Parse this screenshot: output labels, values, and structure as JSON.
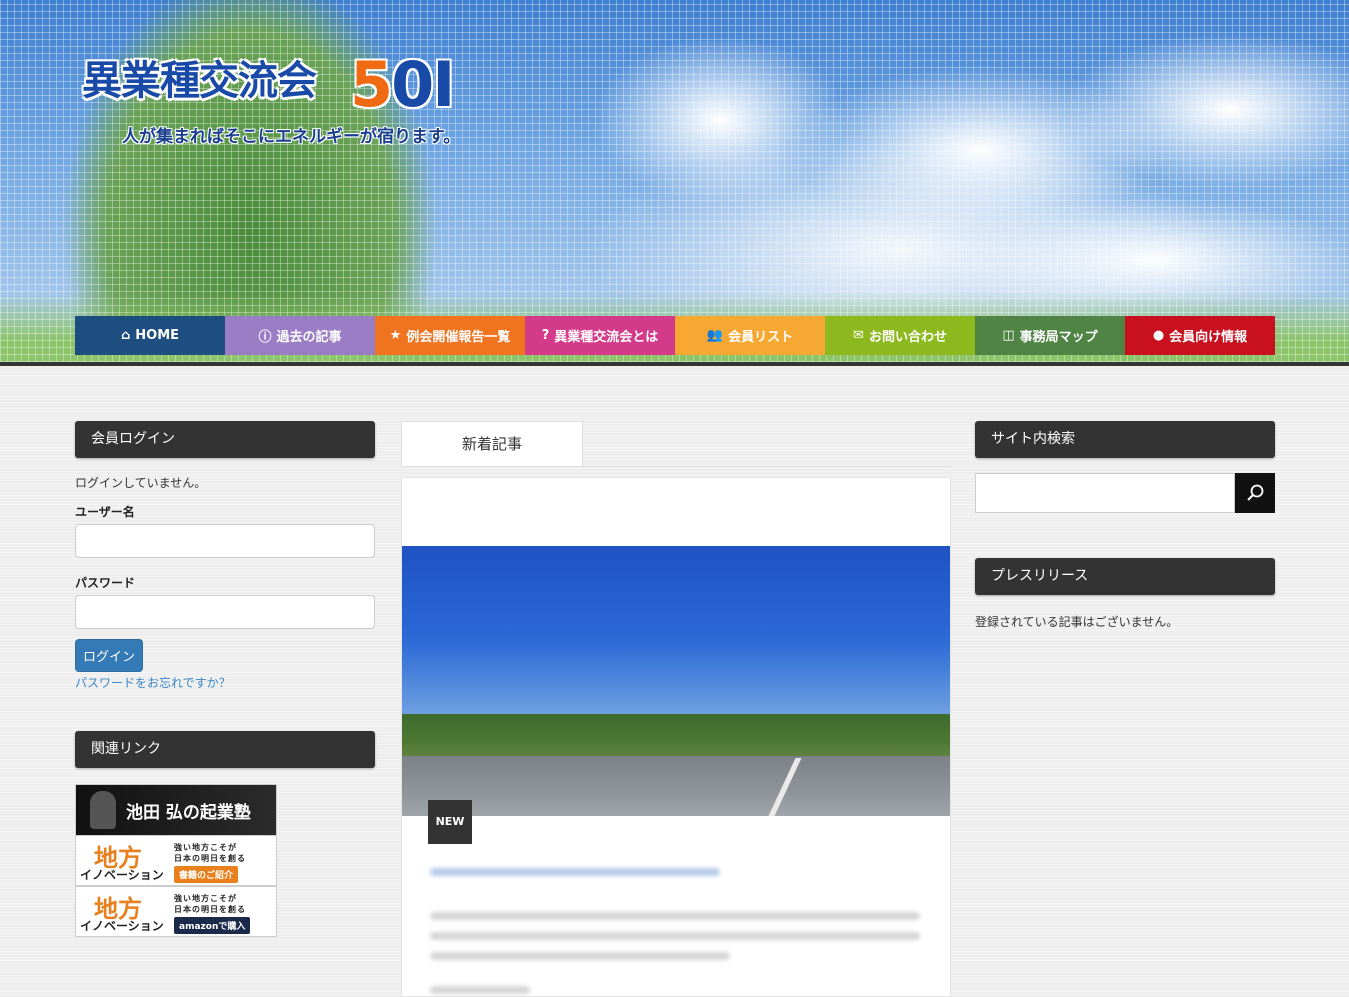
{
  "header": {
    "logo_title": "異業種交流会",
    "logo_number_5": "5",
    "logo_number_rest": "0I",
    "tagline": "人が集まればそこにエネルギーが宿ります。"
  },
  "nav": {
    "items": [
      {
        "label": "HOME",
        "icon": "home-icon",
        "color": "#1d4e7f"
      },
      {
        "label": "過去の記事",
        "icon": "info-icon",
        "color": "#9b7dc6"
      },
      {
        "label": "例会開催報告一覧",
        "icon": "star-icon",
        "color": "#f0731f"
      },
      {
        "label": "異業種交流会とは",
        "icon": "question-icon",
        "color": "#d33a8a"
      },
      {
        "label": "会員リスト",
        "icon": "users-icon",
        "color": "#f7a833"
      },
      {
        "label": "お問い合わせ",
        "icon": "envelope-icon",
        "color": "#8db91f"
      },
      {
        "label": "事務局マップ",
        "icon": "map-icon",
        "color": "#4f8445"
      },
      {
        "label": "会員向け情報",
        "icon": "user-icon",
        "color": "#c8101e"
      }
    ]
  },
  "login_widget": {
    "title": "会員ログイン",
    "status": "ログインしていません。",
    "username_label": "ユーザー名",
    "password_label": "パスワード",
    "login_button": "ログイン",
    "forgot_link": "パスワードをお忘れですか？"
  },
  "links_widget": {
    "title": "関連リンク",
    "banners": [
      {
        "text": "池田 弘の起業塾"
      },
      {
        "big": "地方",
        "innov": "イノベーション",
        "sub1": "強い地方こそが",
        "sub2": "日本の明日を創る",
        "tag": "書籍のご紹介",
        "tag_color": "#e8801d"
      },
      {
        "big": "地方",
        "innov": "イノベーション",
        "sub1": "強い地方こそが",
        "sub2": "日本の明日を創る",
        "tag": "amazonで購入",
        "tag_color": "#1b2a4a"
      }
    ]
  },
  "main": {
    "tab_label": "新着記事",
    "new_badge": "NEW"
  },
  "search_widget": {
    "title": "サイト内検索",
    "placeholder": ""
  },
  "press_widget": {
    "title": "プレスリリース",
    "empty_text": "登録されている記事はございません。"
  }
}
